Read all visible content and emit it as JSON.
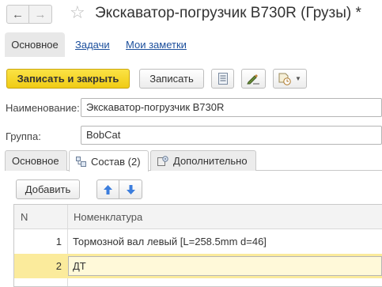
{
  "window": {
    "title": "Экскаватор-погрузчик B730R (Грузы) *"
  },
  "top_tabs": [
    {
      "label": "Основное"
    },
    {
      "label": "Задачи"
    },
    {
      "label": "Мои заметки"
    }
  ],
  "toolbar": {
    "save_close_label": "Записать и закрыть",
    "save_label": "Записать",
    "list_icon": "list-icon",
    "edit_icon": "edit-pencil-icon",
    "action_icon": "document-clock-icon"
  },
  "form": {
    "name_label": "Наименование:",
    "name_value": "Экскаватор-погрузчик B730R",
    "group_label": "Группа:",
    "group_value": "BobCat"
  },
  "inner_tabs": [
    {
      "label": "Основное"
    },
    {
      "label": "Состав (2)"
    },
    {
      "label": "Дополнительно"
    }
  ],
  "table_toolbar": {
    "add_label": "Добавить"
  },
  "table": {
    "columns": [
      "N",
      "Номенклатура"
    ],
    "rows": [
      {
        "n": "1",
        "name": "Тормозной вал левый [L=258.5mm d=46]"
      },
      {
        "n": "2",
        "name": "ДТ"
      }
    ]
  },
  "colors": {
    "primary_button": "#f4d224",
    "selected_row": "#fbeb9c",
    "link": "#1c4f9c"
  }
}
